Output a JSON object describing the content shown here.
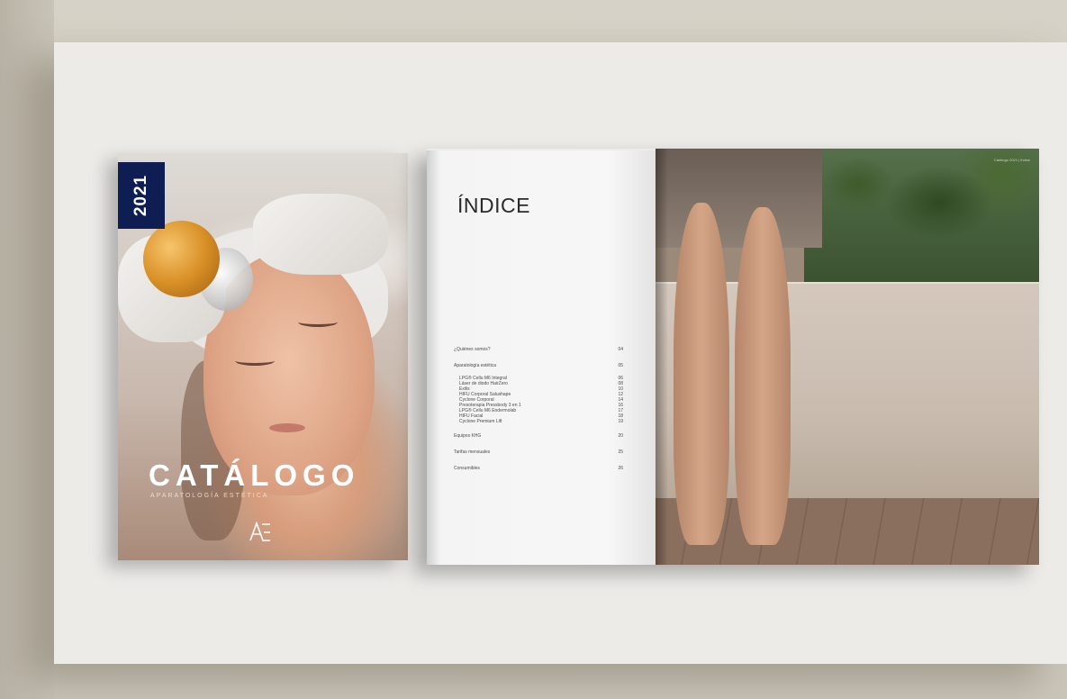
{
  "cover": {
    "year": "2021",
    "title": "CATÁLOGO",
    "subtitle": "APARATOLOGÍA ESTÉTICA",
    "logo": "ΛΞ",
    "brand_color": "#0e1d52"
  },
  "index_page": {
    "title": "ÍNDICE",
    "entries": [
      {
        "label": "¿Quiénes somos?",
        "page": "04",
        "sub": false
      },
      {
        "label": "Aparatología estética",
        "page": "05",
        "sub": false
      },
      {
        "label": "LPG® Cellu M6 Integral",
        "page": "06",
        "sub": true
      },
      {
        "label": "Láser de diodo HairZero",
        "page": "08",
        "sub": true
      },
      {
        "label": "Exilis",
        "page": "10",
        "sub": true
      },
      {
        "label": "HIFU Corporal Salushape",
        "page": "12",
        "sub": true
      },
      {
        "label": "Cyclone Corporal",
        "page": "14",
        "sub": true
      },
      {
        "label": "Presoterapia Pressbody 3 en 1",
        "page": "16",
        "sub": true
      },
      {
        "label": "LPG® Cellu M6 Endermolab",
        "page": "17",
        "sub": true
      },
      {
        "label": "HIFU Facial",
        "page": "18",
        "sub": true
      },
      {
        "label": "Cyclone Premium Lift",
        "page": "19",
        "sub": true
      },
      {
        "label": "Equipos KHG",
        "page": "20",
        "sub": false
      },
      {
        "label": "Tarifas mensuales",
        "page": "25",
        "sub": false
      },
      {
        "label": "Consumibles",
        "page": "26",
        "sub": false
      }
    ]
  },
  "photo_page": {
    "header": "Catálogo 2021 | Índice"
  }
}
